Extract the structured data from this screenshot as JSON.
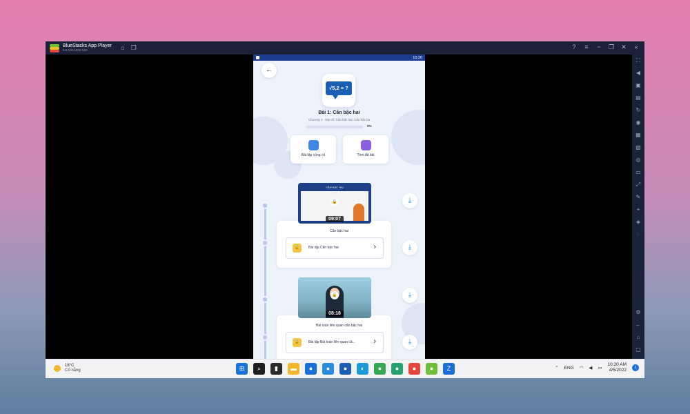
{
  "window": {
    "title": "BlueStacks App Player",
    "version": "5.6.100.1026  N32"
  },
  "status_bar": {
    "time": "10:20"
  },
  "lesson": {
    "thumb_text": "√5,2 = ?",
    "title": "Bài 1: Căn bậc hai",
    "subtitle": "Chương 1 · Đại số: Căn bậc hai. Căn bậc ba",
    "progress_label": "0%",
    "progress_fraction": 0.0
  },
  "actions": [
    {
      "label": "Bài tập củng cố",
      "icon": "exercise-book-icon",
      "color": "#3c86e6"
    },
    {
      "label": "Tóm tắt bài",
      "icon": "summary-icon",
      "color": "#8a5ee0"
    }
  ],
  "videos": [
    {
      "slide_heading": "CĂN BẬC HAI",
      "duration": "09:07",
      "title": "Căn bậc hai",
      "exercise": "Bài tập Căn bậc hai"
    },
    {
      "duration": "08:18",
      "title": "Bài toán liên quan căn bậc hai",
      "exercise": "Bài tập Bài toán liên quan că..."
    }
  ],
  "taskbar": {
    "temperature": "18°C",
    "weather": "Có nắng",
    "language": "ENG",
    "time": "10:20 AM",
    "date": "4/5/2022",
    "notification_count": "1",
    "apps": [
      {
        "icon": "windows-start-icon",
        "color": "#1a73d8"
      },
      {
        "icon": "search-icon",
        "color": "#1f1f1f"
      },
      {
        "icon": "task-view-icon",
        "color": "#2a2a2a"
      },
      {
        "icon": "file-explorer-icon",
        "color": "#f2b72a"
      },
      {
        "icon": "app-icon-1",
        "color": "#1a6ed8"
      },
      {
        "icon": "app-icon-2",
        "color": "#2b8be0"
      },
      {
        "icon": "app-icon-3",
        "color": "#1a5fb4"
      },
      {
        "icon": "edge-icon",
        "color": "#1a9ad8"
      },
      {
        "icon": "chrome-icon-1",
        "color": "#34a853"
      },
      {
        "icon": "app-icon-4",
        "color": "#28a26b"
      },
      {
        "icon": "chrome-icon-2",
        "color": "#e5473d"
      },
      {
        "icon": "bluestacks-icon",
        "color": "#6fbf3b"
      },
      {
        "icon": "zalo-icon",
        "color": "#1a6ed8"
      }
    ]
  }
}
